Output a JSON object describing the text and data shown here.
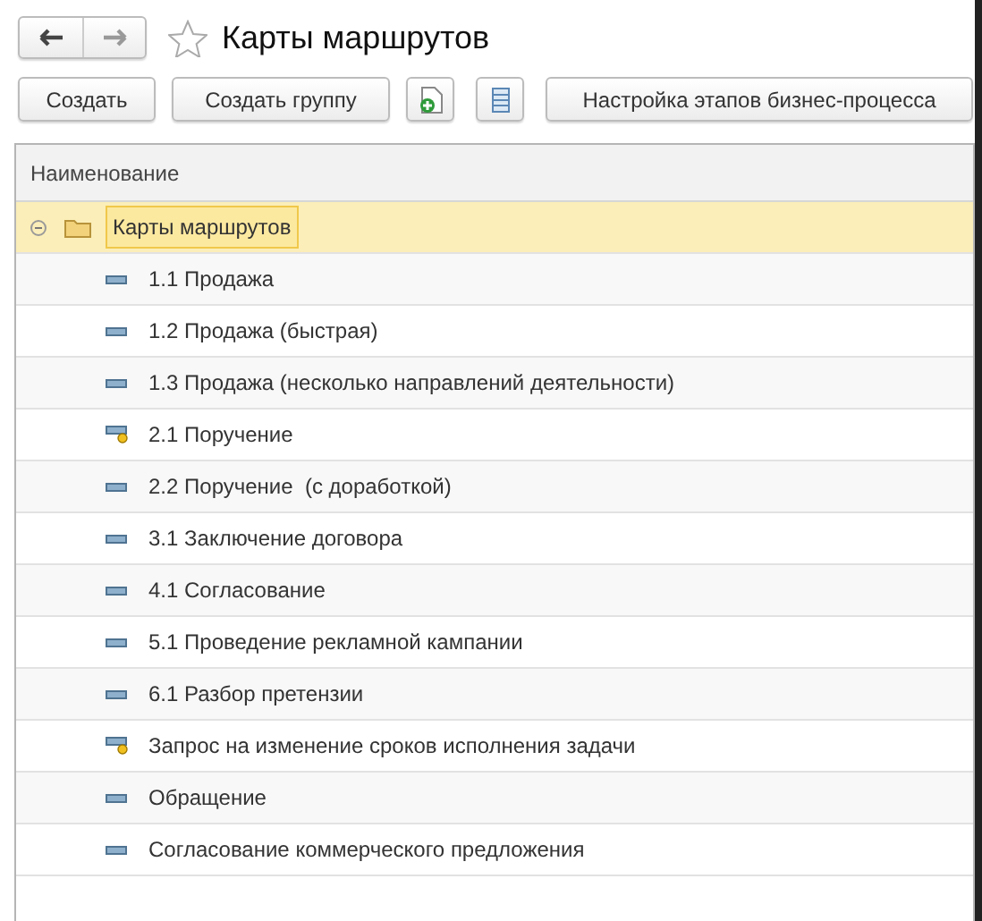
{
  "window": {
    "title": "Карты маршрутов",
    "favorite": false
  },
  "toolbar": {
    "buttons": [
      {
        "kind": "text",
        "label": "Создать"
      },
      {
        "kind": "text",
        "label": "Создать группу"
      },
      {
        "kind": "add-copy"
      },
      {
        "kind": "list"
      },
      {
        "kind": "text",
        "label": "Настройка этапов бизнес-процесса"
      }
    ]
  },
  "table": {
    "columns": [
      "Наименование"
    ],
    "rows": [
      {
        "kind": "group",
        "label": "Карты маршрутов",
        "expanded": true,
        "selected": true,
        "children": [
          {
            "kind": "item",
            "label": "1.1 Продажа",
            "marked": false,
            "selected": false
          },
          {
            "kind": "item",
            "label": "1.2 Продажа (быстрая)",
            "marked": false,
            "selected": false
          },
          {
            "kind": "item",
            "label": "1.3 Продажа (несколько направлений деятельности)",
            "marked": false,
            "selected": false
          },
          {
            "kind": "item",
            "label": "2.1 Поручение",
            "marked": true,
            "selected": false
          },
          {
            "kind": "item",
            "label": "2.2 Поручение  (с доработкой)",
            "marked": false,
            "selected": false
          },
          {
            "kind": "item",
            "label": "3.1 Заключение договора",
            "marked": false,
            "selected": false
          },
          {
            "kind": "item",
            "label": "4.1 Согласование",
            "marked": false,
            "selected": false
          },
          {
            "kind": "item",
            "label": "5.1 Проведение рекламной кампании",
            "marked": false,
            "selected": false
          },
          {
            "kind": "item",
            "label": "6.1 Разбор претензии",
            "marked": false,
            "selected": false
          },
          {
            "kind": "item",
            "label": "Запрос на изменение сроков исполнения задачи",
            "marked": true,
            "selected": false
          },
          {
            "kind": "item",
            "label": "Обращение",
            "marked": false,
            "selected": false
          },
          {
            "kind": "item",
            "label": "Согласование коммерческого предложения",
            "marked": false,
            "selected": false
          }
        ]
      }
    ]
  }
}
